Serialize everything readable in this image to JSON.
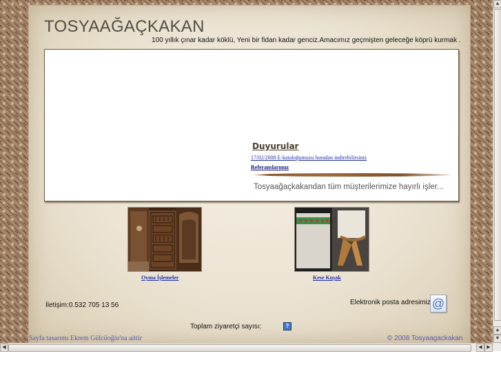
{
  "site": {
    "title": "TOSYAAĞAÇKAKAN",
    "tagline": "100 yıllık çınar kadar köklü, Yeni bir fidan kadar genciz.Amacımız geçmişten geleceğe köprü kurmak ."
  },
  "announcements": {
    "title": "Duyurular",
    "item_text": "17/02/2008 E-kataloğumuzu buradan indirebilirsiniz",
    "references_label": "Referanslarımız"
  },
  "marquee": {
    "text": "Tosyaağaçkakandan tüm müşterilerimize hayırlı işler..."
  },
  "gallery": [
    {
      "caption": "Oyma İşlemeler",
      "icon": "carved-wood-door-photo"
    },
    {
      "caption": "Kese Kuşak",
      "icon": "embroidered-sash-photo"
    }
  ],
  "contact": {
    "phone_text": "İletişim:0.532 705 13 56",
    "email_label": "Elektronik posta adresimiz",
    "email_icon": "at-sign-icon"
  },
  "counter": {
    "label": "Toplam ziyaretçi sayısı:",
    "icon": "?"
  },
  "footer": {
    "design_credit": "Sayfa  tasarımı Ekrem Gülcüoğlu'na aittir",
    "copyright": "© 2008 Tosyaagackakan"
  },
  "colors": {
    "link": "#1d2fa8",
    "heading": "#4a3c2c",
    "footer_text": "#5b5ca6"
  }
}
